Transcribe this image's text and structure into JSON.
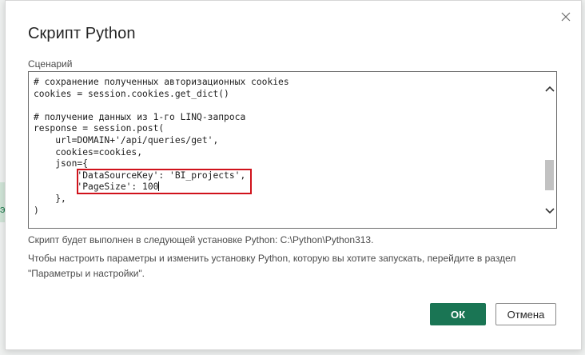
{
  "background": {
    "strip_text": "э"
  },
  "dialog": {
    "title": "Скрипт Python",
    "close_icon": "close-icon",
    "field_label": "Сценарий",
    "script": {
      "lines": [
        "# сохранение полученных авторизационных cookies",
        "cookies = session.cookies.get_dict()",
        "",
        "# получение данных из 1-го LINQ-запроса",
        "response = session.post(",
        "    url=DOMAIN+'/api/queries/get',",
        "    cookies=cookies,",
        "    json={",
        "        'DataSourceKey': 'BI_projects',",
        "        'PageSize': 100",
        "    },",
        ")"
      ]
    },
    "info_line_1": "Скрипт будет выполнен в следующей установке Python: C:\\Python\\Python313.",
    "info_line_2": "Чтобы настроить параметры и изменить установку Python, которую вы хотите запускать, перейдите в раздел",
    "info_line_3": "\"Параметры и настройки\".",
    "ok_label": "ОК",
    "cancel_label": "Отмена"
  },
  "colors": {
    "primary_button": "#1a7554",
    "highlight_border": "#d0121b"
  }
}
